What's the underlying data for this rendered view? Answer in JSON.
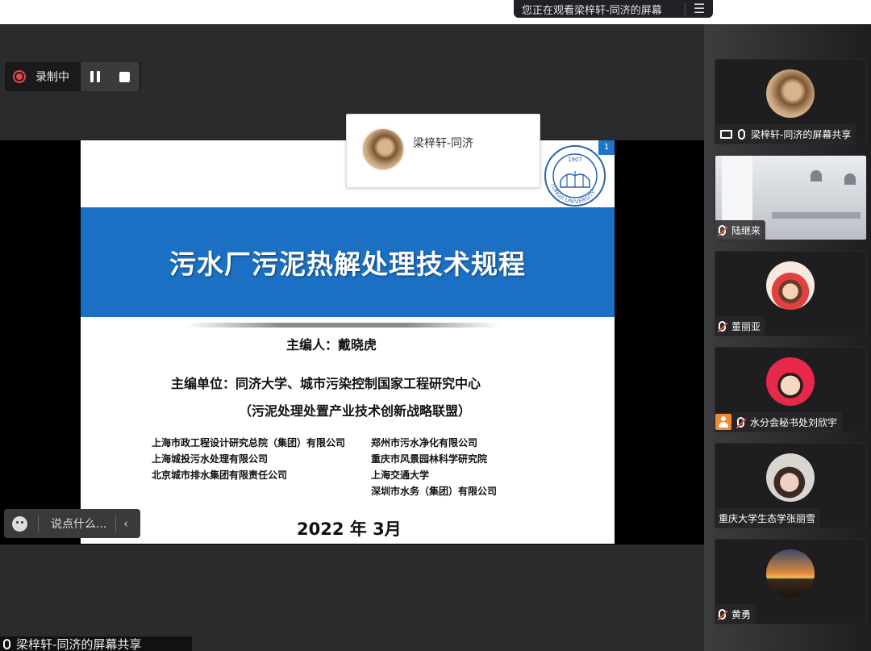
{
  "viewing_banner": {
    "text": "您正在观看梁梓轩-同济的屏幕",
    "menu_icon": "menu-icon"
  },
  "recording": {
    "label": "录制中",
    "pause_icon": "pause-icon",
    "stop_icon": "stop-icon"
  },
  "presenter_popup": {
    "name": "梁梓轩-同济"
  },
  "slide": {
    "page_number": "1",
    "title": "污水厂污泥热解处理技术规程",
    "editor": "主编人：戴晓虎",
    "unit": "主编单位：同济大学、城市污染控制国家工程研究中心",
    "alliance": "（污泥处理处置产业技术创新战略联盟）",
    "orgs_left": [
      "上海市政工程设计研究总院（集团）有限公司",
      "上海城投污水处理有限公司",
      "北京城市排水集团有限责任公司"
    ],
    "orgs_right": [
      "郑州市污水净化有限公司",
      "重庆市风景园林科学研究院",
      "上海交通大学",
      "深圳市水务（集团）有限公司"
    ],
    "date": "2022 年 3月",
    "logo_text": "TONGJI UNIVERSITY",
    "logo_year": "1907"
  },
  "chat": {
    "placeholder": "说点什么...",
    "emoji_icon": "emoji-icon",
    "collapse_icon": "chevron-left-icon"
  },
  "bottom_label": "梁梓轩-同济的屏幕共享",
  "participants": [
    {
      "name": "梁梓轩-同济的屏幕共享",
      "mic": "on",
      "sharing": true
    },
    {
      "name": "陆继来",
      "mic": "muted"
    },
    {
      "name": "董丽亚",
      "mic": "muted"
    },
    {
      "name": "水分会秘书处刘欣宇",
      "mic": "muted",
      "role_icon": "person-icon"
    },
    {
      "name": "重庆大学生态学张丽雪",
      "mic": "none"
    },
    {
      "name": "黄勇",
      "mic": "muted"
    }
  ],
  "colors": {
    "slide_blue": "#1b70c4",
    "record_red": "#e84848",
    "role_orange": "#f08a2c"
  }
}
